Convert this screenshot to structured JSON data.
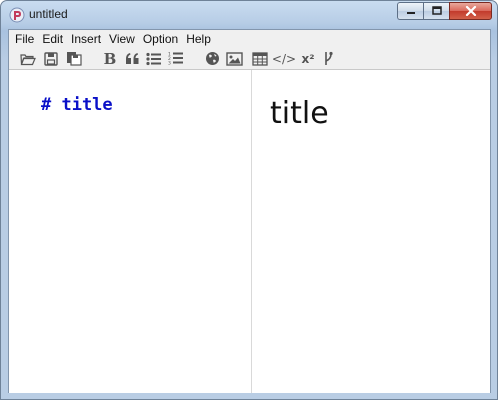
{
  "window": {
    "title": "untitled",
    "controls": [
      "minimize",
      "maximize",
      "close"
    ]
  },
  "menu": {
    "items": [
      "File",
      "Edit",
      "Insert",
      "View",
      "Option",
      "Help"
    ]
  },
  "toolbar": {
    "items": [
      {
        "icon": "open-folder-icon"
      },
      {
        "icon": "save-icon"
      },
      {
        "icon": "save-as-icon"
      },
      {
        "icon": "bold-icon",
        "label": "B"
      },
      {
        "icon": "blockquote-icon",
        "label": "❝"
      },
      {
        "icon": "bullet-list-icon"
      },
      {
        "icon": "numbered-list-icon"
      },
      {
        "icon": "link-globe-icon"
      },
      {
        "icon": "image-icon"
      },
      {
        "icon": "table-icon"
      },
      {
        "icon": "code-icon",
        "label": "</>"
      },
      {
        "icon": "superscript-icon",
        "label": "x²"
      },
      {
        "icon": "branch-icon"
      }
    ]
  },
  "editor": {
    "content": "# title"
  },
  "preview": {
    "heading": "title"
  }
}
